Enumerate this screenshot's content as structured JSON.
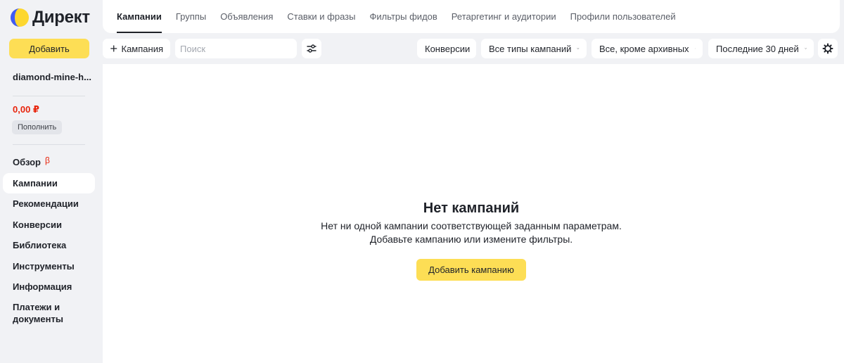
{
  "app": {
    "logo_text": "Директ",
    "brand_colors": {
      "accent_yellow": "#fdde55",
      "logo_blue": "#3f5bf5",
      "logo_yellow": "#fdd72f",
      "red": "#e8240c"
    }
  },
  "sidebar": {
    "add_label": "Добавить",
    "account_name": "diamond-mine-h...",
    "balance": "0,00 ₽",
    "topup_label": "Пополнить",
    "items": [
      {
        "label": "Обзор",
        "badge": "β"
      },
      {
        "label": "Кампании",
        "active": true
      },
      {
        "label": "Рекомендации"
      },
      {
        "label": "Конверсии"
      },
      {
        "label": "Библиотека"
      },
      {
        "label": "Инструменты"
      },
      {
        "label": "Информация"
      },
      {
        "label": "Платежи и документы"
      }
    ]
  },
  "tabs": [
    {
      "label": "Кампании",
      "active": true
    },
    {
      "label": "Группы"
    },
    {
      "label": "Объявления"
    },
    {
      "label": "Ставки и фразы"
    },
    {
      "label": "Фильтры фидов"
    },
    {
      "label": "Ретаргетинг и аудитории"
    },
    {
      "label": "Профили пользователей"
    }
  ],
  "toolbar": {
    "new_campaign_label": "Кампания",
    "search_placeholder": "Поиск",
    "filter_icon": "filter-sliders-icon",
    "conversions_label": "Конверсии",
    "campaign_types": "Все типы кампаний",
    "status_filter": "Все, кроме архивных",
    "period": "Последние 30 дней",
    "settings_icon": "gear-icon"
  },
  "empty_state": {
    "title": "Нет кампаний",
    "line1": "Нет ни одной кампании соответствующей заданным параметрам.",
    "line2": "Добавьте кампанию или измените фильтры.",
    "button": "Добавить кампанию"
  }
}
